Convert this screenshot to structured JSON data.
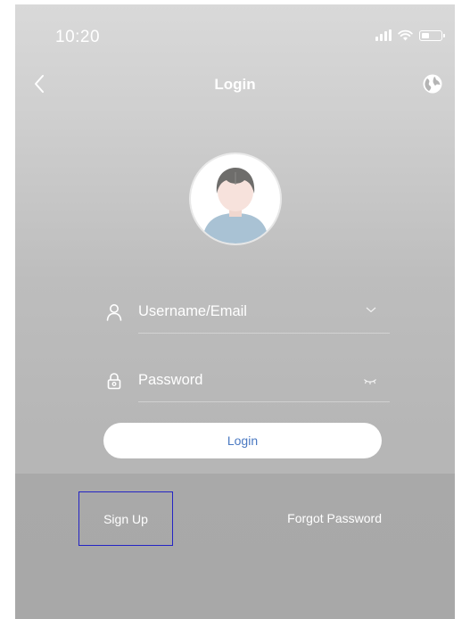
{
  "status_bar": {
    "time": "10:20",
    "icons": [
      "signal-icon",
      "wifi-icon",
      "battery-icon"
    ]
  },
  "header": {
    "title": "Login",
    "back_icon": "chevron-left-icon",
    "language_icon": "globe-icon"
  },
  "avatar": {
    "icon": "default-user-avatar"
  },
  "form": {
    "username": {
      "placeholder": "Username/Email",
      "icon": "user-icon",
      "right_icon": "chevron-down-icon"
    },
    "password": {
      "placeholder": "Password",
      "icon": "lock-icon",
      "right_icon": "eye-closed-icon"
    },
    "login_label": "Login"
  },
  "footer": {
    "signup_label": "Sign Up",
    "forgot_label": "Forgot Password"
  },
  "colors": {
    "accent_text": "#4a79c2",
    "background_top": "#d9d9d9",
    "background_bottom": "#b4b4b4",
    "highlight_box": "#2424c4"
  }
}
